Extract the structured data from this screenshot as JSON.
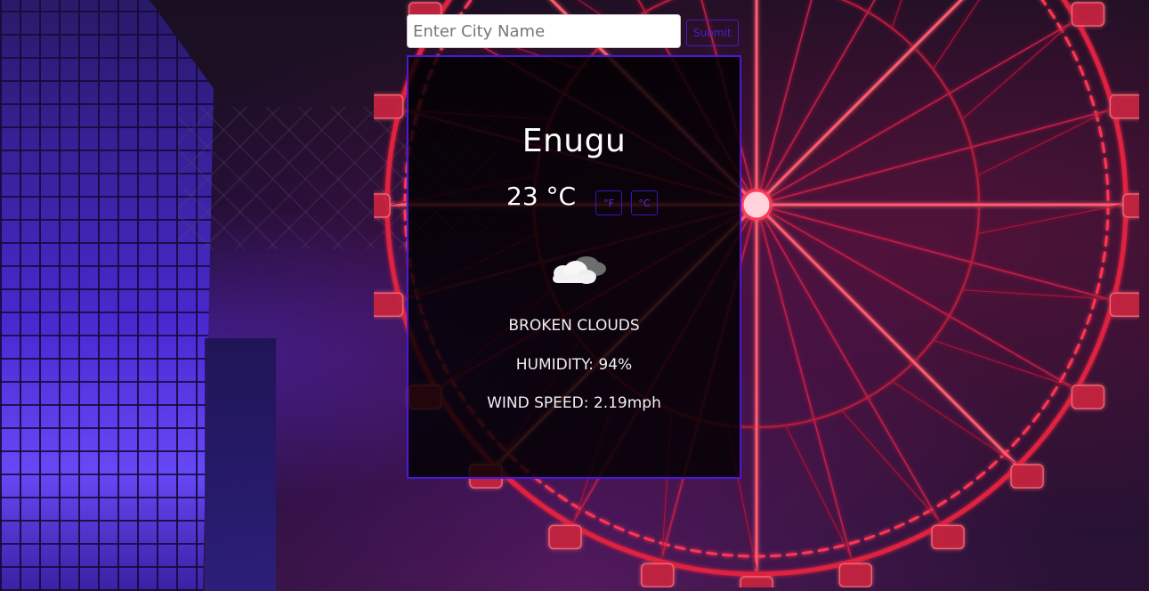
{
  "search": {
    "placeholder": "Enter City Name",
    "value": "",
    "submit_label": "Submit"
  },
  "weather": {
    "city": "Enugu",
    "temperature": "23 °C",
    "unit_f_label": "°F",
    "unit_c_label": "°C",
    "icon": "broken-clouds-icon",
    "description": "BROKEN CLOUDS",
    "humidity": "HUMIDITY: 94%",
    "wind_speed": "WIND SPEED: 2.19mph"
  },
  "colors": {
    "accent": "#4b18d8",
    "card_bg": "#000000",
    "text": "#ffffff"
  }
}
